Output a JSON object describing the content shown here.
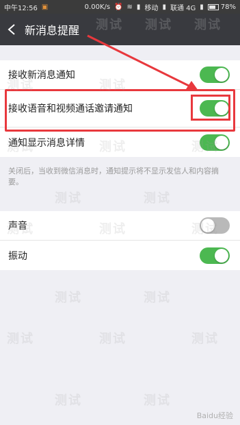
{
  "status_bar": {
    "carrier_time": "中午12:56",
    "speed": "0.00K/s",
    "carrier1": "移动",
    "carrier2": "联通 4G",
    "battery": "78%"
  },
  "header": {
    "title": "新消息提醒"
  },
  "group1": {
    "rows": [
      {
        "label": "接收新消息通知",
        "on": true
      },
      {
        "label": "接收语音和视频通话邀请通知",
        "on": true
      },
      {
        "label": "通知显示消息详情",
        "on": true
      }
    ],
    "hint": "关闭后，当收到微信消息时，通知提示将不显示发信人和内容摘要。"
  },
  "group2": {
    "rows": [
      {
        "label": "声音",
        "on": false
      },
      {
        "label": "振动",
        "on": true
      }
    ]
  },
  "watermark_text": "测试",
  "baidu_mark": "Baidu经验",
  "colors": {
    "toggle_on": "#4cb851",
    "toggle_off": "#b9b9b9",
    "header_bg": "#393a3f",
    "annotation_red": "#e8383d"
  }
}
